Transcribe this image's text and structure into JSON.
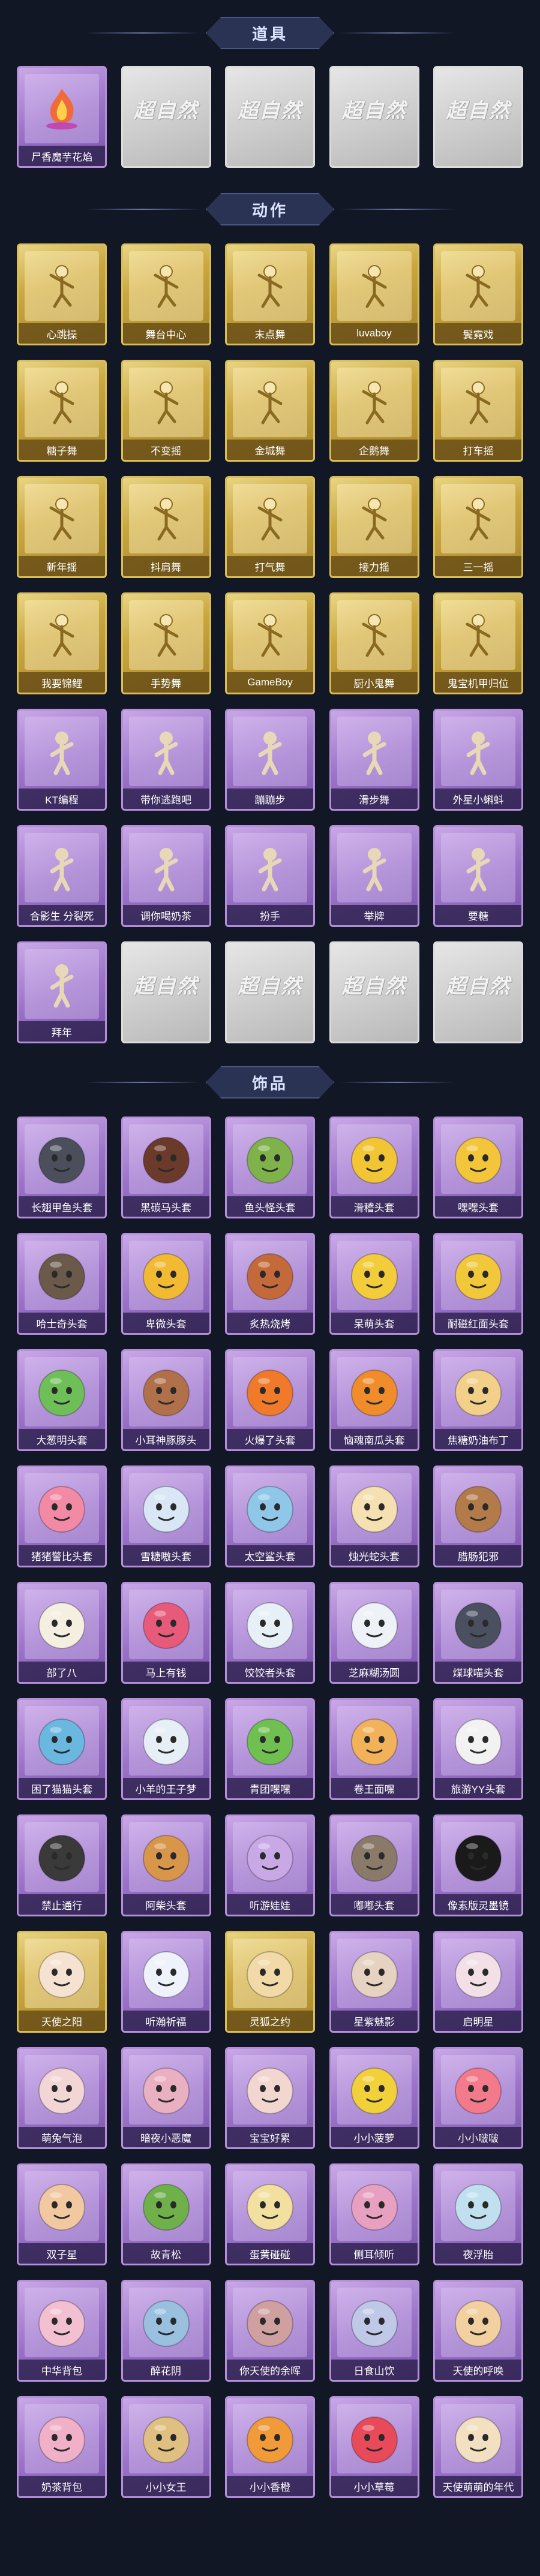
{
  "sections": {
    "props": {
      "title": "道具",
      "items": [
        {
          "label": "尸香魔芋花焰",
          "style": "purple",
          "icon": "flower-flame-icon"
        },
        {
          "label": "",
          "style": "grey",
          "icon": "locked-placeholder-icon"
        },
        {
          "label": "",
          "style": "grey",
          "icon": "locked-placeholder-icon"
        },
        {
          "label": "",
          "style": "grey",
          "icon": "locked-placeholder-icon"
        },
        {
          "label": "",
          "style": "grey",
          "icon": "locked-placeholder-icon"
        }
      ]
    },
    "actions": {
      "title": "动作",
      "items": [
        {
          "label": "心跳操",
          "style": "gold"
        },
        {
          "label": "舞台中心",
          "style": "gold"
        },
        {
          "label": "末点舞",
          "style": "gold"
        },
        {
          "label": "luvaboy",
          "style": "gold"
        },
        {
          "label": "鬓霓戏",
          "style": "gold"
        },
        {
          "label": "糖子舞",
          "style": "gold"
        },
        {
          "label": "不变摇",
          "style": "gold"
        },
        {
          "label": "金城舞",
          "style": "gold"
        },
        {
          "label": "企鹅舞",
          "style": "gold"
        },
        {
          "label": "打车摇",
          "style": "gold"
        },
        {
          "label": "新年摇",
          "style": "gold"
        },
        {
          "label": "抖肩舞",
          "style": "gold"
        },
        {
          "label": "打气舞",
          "style": "gold"
        },
        {
          "label": "接力摇",
          "style": "gold"
        },
        {
          "label": "三一摇",
          "style": "gold"
        },
        {
          "label": "我要锦鲤",
          "style": "gold"
        },
        {
          "label": "手势舞",
          "style": "gold"
        },
        {
          "label": "GameBoy",
          "style": "gold"
        },
        {
          "label": "厨小鬼舞",
          "style": "gold"
        },
        {
          "label": "鬼宝机甲归位",
          "style": "gold"
        },
        {
          "label": "KT编程",
          "style": "purple"
        },
        {
          "label": "带你逃跑吧",
          "style": "purple"
        },
        {
          "label": "蹦蹦步",
          "style": "purple"
        },
        {
          "label": "滑步舞",
          "style": "purple"
        },
        {
          "label": "外星小蝌蚪",
          "style": "purple"
        },
        {
          "label": "合影生 分裂死",
          "style": "purple"
        },
        {
          "label": "调你喝奶茶",
          "style": "purple"
        },
        {
          "label": "扮手",
          "style": "purple"
        },
        {
          "label": "举牌",
          "style": "purple"
        },
        {
          "label": "要糖",
          "style": "purple"
        },
        {
          "label": "拜年",
          "style": "purple"
        },
        {
          "label": "",
          "style": "grey"
        },
        {
          "label": "",
          "style": "grey"
        },
        {
          "label": "",
          "style": "grey"
        },
        {
          "label": "",
          "style": "grey"
        }
      ]
    },
    "accessories": {
      "title": "饰品",
      "items": [
        {
          "label": "长翅甲鱼头套",
          "color": "#4b4f5c"
        },
        {
          "label": "黑碳马头套",
          "color": "#6b3a2a"
        },
        {
          "label": "鱼头怪头套",
          "color": "#7fb24a"
        },
        {
          "label": "滑稽头套",
          "color": "#f2c534"
        },
        {
          "label": "嘿嘿头套",
          "color": "#f3c53a"
        },
        {
          "label": "哈士奇头套",
          "color": "#6b5a4a"
        },
        {
          "label": "卑微头套",
          "color": "#f2b933"
        },
        {
          "label": "炙热烧烤",
          "color": "#c46a3a"
        },
        {
          "label": "呆萌头套",
          "color": "#f2cc3a"
        },
        {
          "label": "耐磁红面头套",
          "color": "#f0c83a"
        },
        {
          "label": "大葱明头套",
          "color": "#6fbf58"
        },
        {
          "label": "小耳神豚豚头",
          "color": "#b0704a"
        },
        {
          "label": "火爆了头套",
          "color": "#f07a2a"
        },
        {
          "label": "恼魂南瓜头套",
          "color": "#f08c2a"
        },
        {
          "label": "焦糖奶油布丁",
          "color": "#f2d08a"
        },
        {
          "label": "猪猪警比头套",
          "color": "#f28aa6"
        },
        {
          "label": "雪糖嗷头套",
          "color": "#d8e6f6"
        },
        {
          "label": "太空鲨头套",
          "color": "#8fc7e8"
        },
        {
          "label": "烛光蛇头套",
          "color": "#f4e0b0"
        },
        {
          "label": "腊肠犯邪",
          "color": "#b37a4a"
        },
        {
          "label": "部了八",
          "color": "#f4efe0"
        },
        {
          "label": "马上有钱",
          "color": "#e85a7a"
        },
        {
          "label": "饺饺者头套",
          "color": "#e6f0f6"
        },
        {
          "label": "芝麻糊汤圆",
          "color": "#eef2f6"
        },
        {
          "label": "煤球喵头套",
          "color": "#4a5060"
        },
        {
          "label": "困了猫猫头套",
          "color": "#6ab8e0"
        },
        {
          "label": "小羊的王子梦",
          "color": "#e6eef6"
        },
        {
          "label": "青团嘿嘿",
          "color": "#6fc050"
        },
        {
          "label": "卷王面嘿",
          "color": "#f2b25a"
        },
        {
          "label": "旅游YY头套",
          "color": "#f2f2f2"
        },
        {
          "label": "禁止通行",
          "color": "#3a3a3a"
        },
        {
          "label": "阿柴头套",
          "color": "#d8964a"
        },
        {
          "label": "听游娃娃",
          "color": "#c9a8e6"
        },
        {
          "label": "嘟嘟头套",
          "color": "#8a7a6a"
        },
        {
          "label": "像素版灵墨镜",
          "color": "#1a1a1a"
        },
        {
          "label": "天使之阳",
          "color": "#f6e2d0"
        },
        {
          "label": "听瀚祈福",
          "color": "#eef2fa"
        },
        {
          "label": "灵狐之约",
          "color": "#f2d9a8"
        },
        {
          "label": "星紫魅影",
          "color": "#e6d2c0"
        },
        {
          "label": "启明星",
          "color": "#f2e0e6"
        },
        {
          "label": "萌兔气泡",
          "color": "#f2d6d6"
        },
        {
          "label": "暗夜小恶魔",
          "color": "#e8b0c0"
        },
        {
          "label": "宝宝好累",
          "color": "#f2d6d0"
        },
        {
          "label": "小小菠萝",
          "color": "#f2d03a"
        },
        {
          "label": "小小啵啵",
          "color": "#f27a8a"
        },
        {
          "label": "双子星",
          "color": "#f2c8a0"
        },
        {
          "label": "故青松",
          "color": "#6fb04a"
        },
        {
          "label": "蛋黄碰碰",
          "color": "#f2e0a0"
        },
        {
          "label": "侧耳倾听",
          "color": "#e8a0c0"
        },
        {
          "label": "夜浮胎",
          "color": "#c0e0f0"
        },
        {
          "label": "中华背包",
          "color": "#f2c0d0"
        },
        {
          "label": "醉花阴",
          "color": "#9ac0e0"
        },
        {
          "label": "你天使的余晖",
          "color": "#d0a0a0"
        },
        {
          "label": "日食山饮",
          "color": "#c0c8e8"
        },
        {
          "label": "天使的呼唤",
          "color": "#f2d0a0"
        },
        {
          "label": "奶茶背包",
          "color": "#f0b0c8"
        },
        {
          "label": "小小女王",
          "color": "#e0c080"
        },
        {
          "label": "小小香橙",
          "color": "#f09a3a"
        },
        {
          "label": "小小草莓",
          "color": "#e84a5a"
        },
        {
          "label": "天使萌萌的年代",
          "color": "#f2e0c0"
        }
      ]
    }
  },
  "watermark_text": "超自然"
}
